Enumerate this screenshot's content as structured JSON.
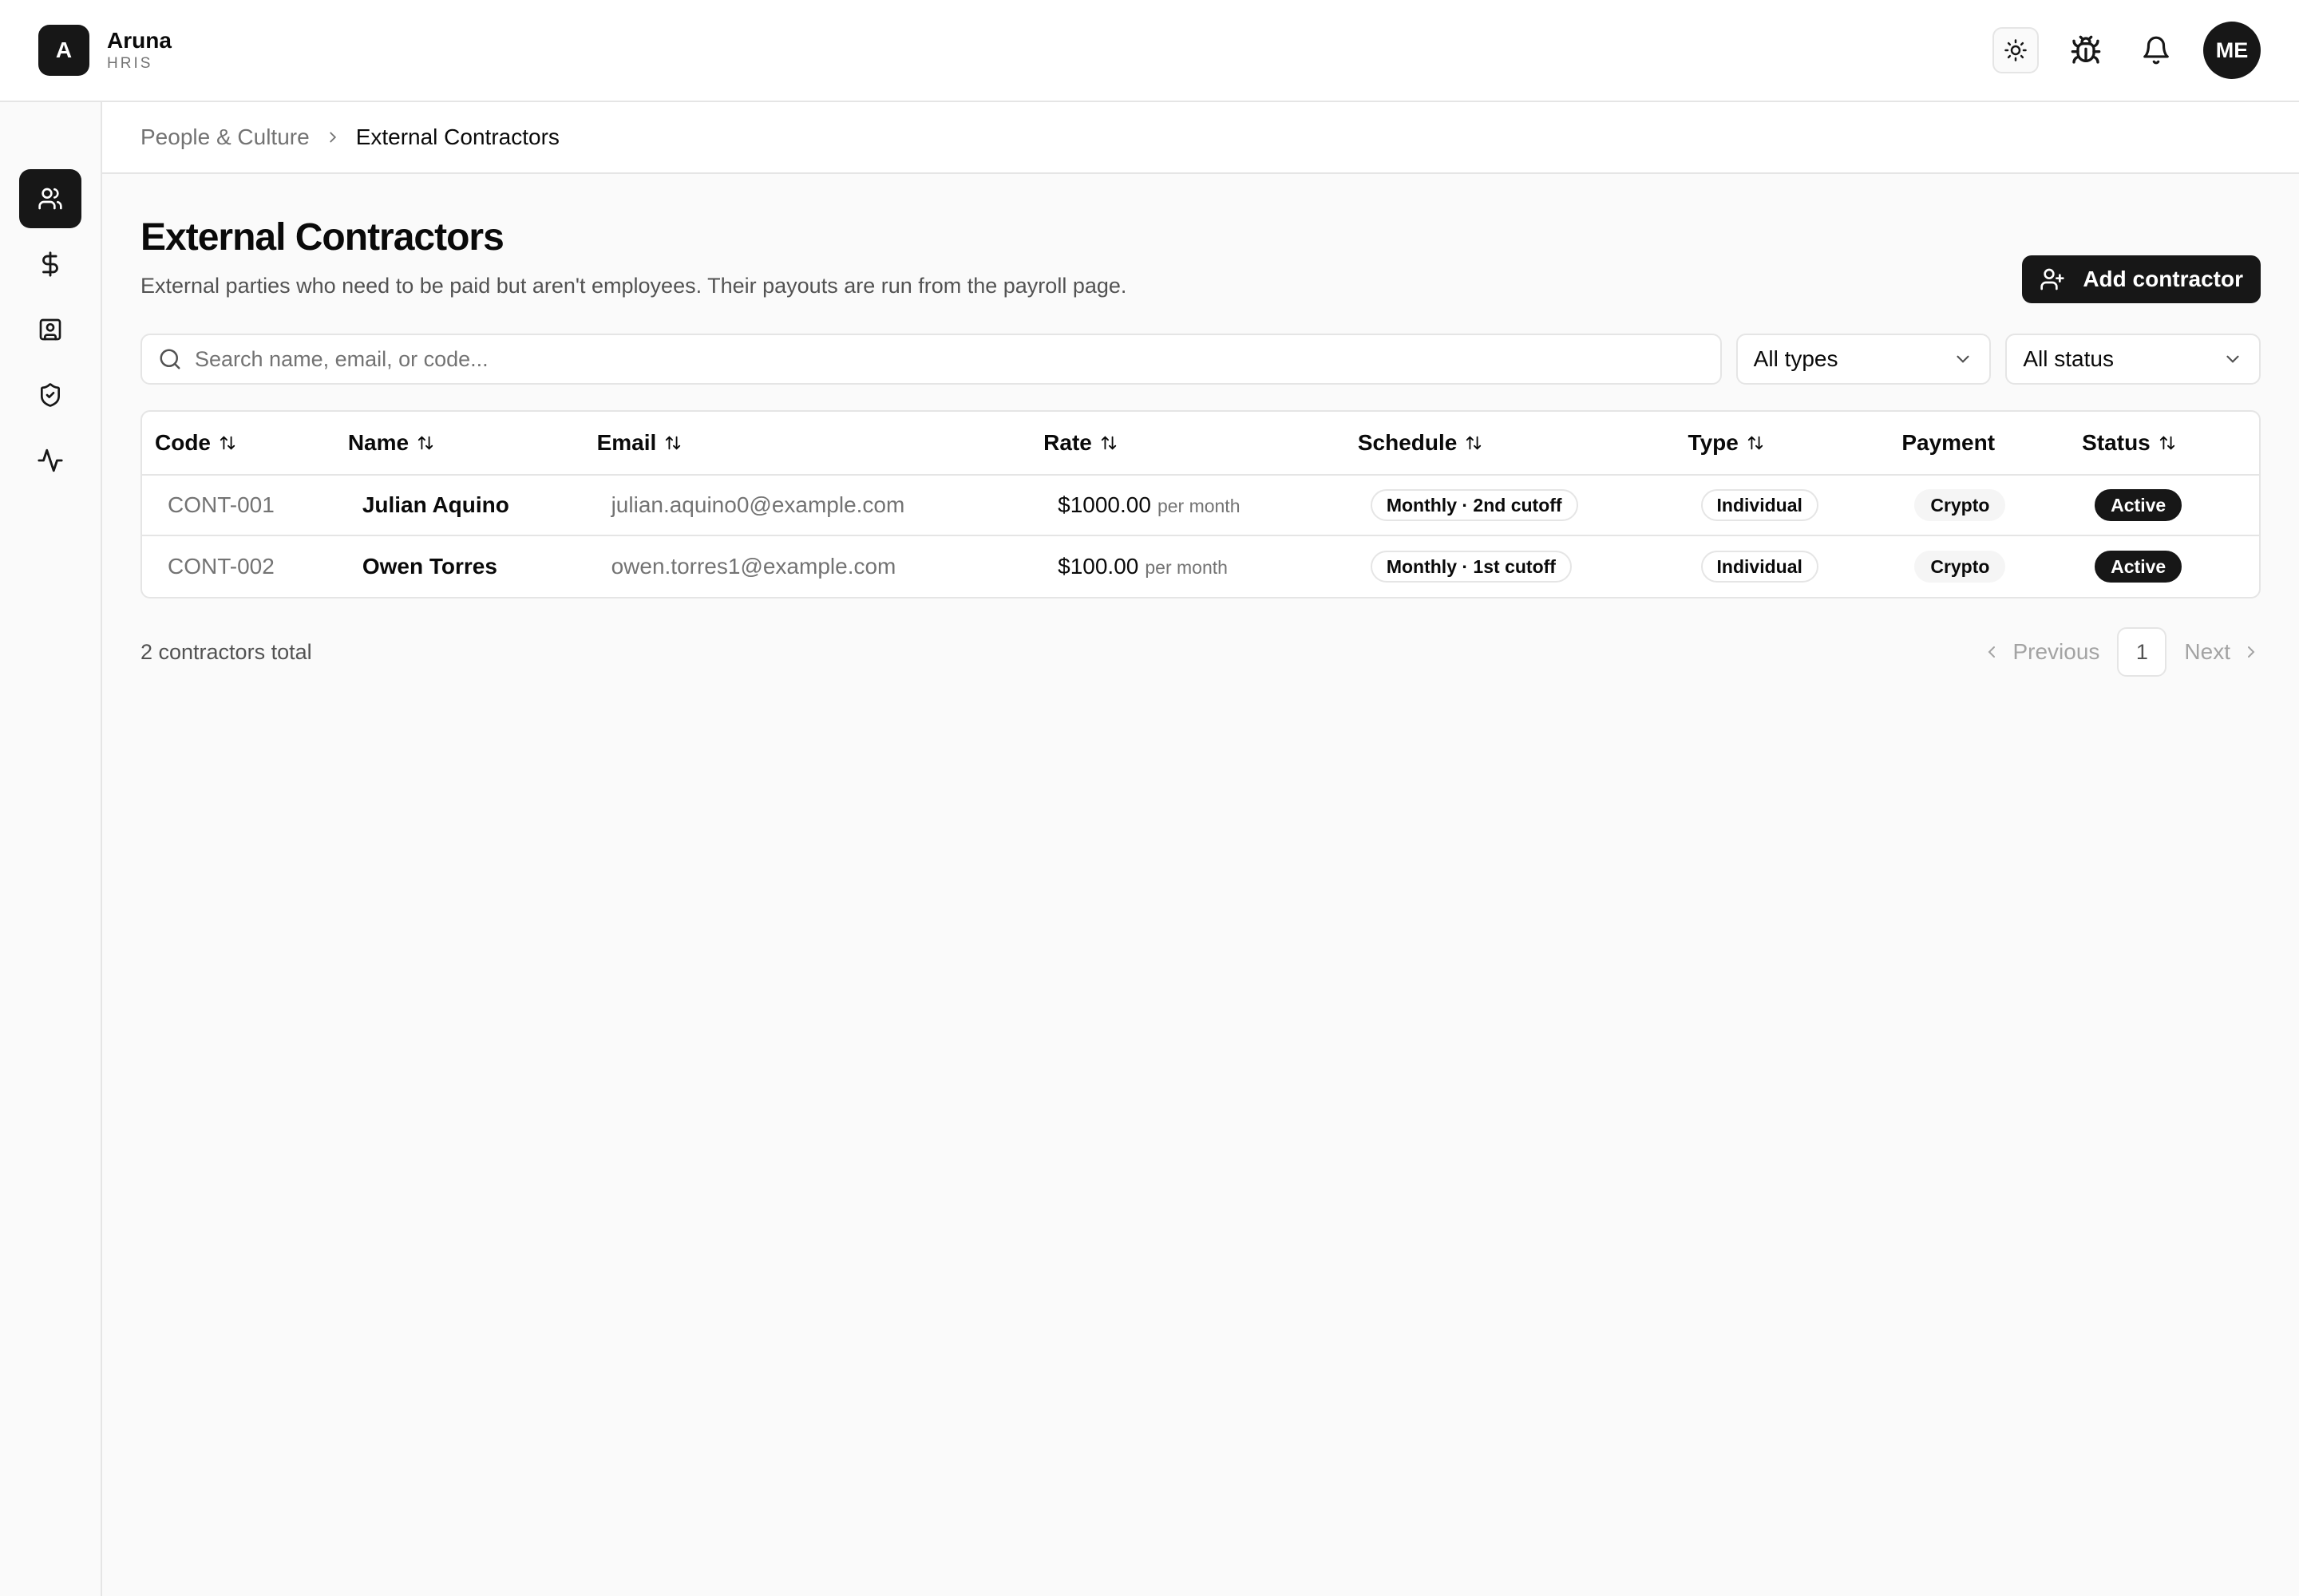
{
  "brand": {
    "logo_letter": "A",
    "name": "Aruna",
    "sub": "HRIS"
  },
  "topbar": {
    "icons": [
      "sun-icon",
      "bug-icon",
      "bell-icon"
    ],
    "avatar_initials": "ME"
  },
  "sidebar": {
    "items": [
      {
        "icon": "users-icon",
        "active": true
      },
      {
        "icon": "dollar-icon",
        "active": false
      },
      {
        "icon": "contact-card-icon",
        "active": false
      },
      {
        "icon": "shield-check-icon",
        "active": false
      },
      {
        "icon": "activity-icon",
        "active": false
      }
    ]
  },
  "breadcrumb": {
    "parent": "People & Culture",
    "current": "External Contractors"
  },
  "page": {
    "title": "External Contractors",
    "description": "External parties who need to be paid but aren't employees. Their payouts are run from the payroll page.",
    "add_button": "Add contractor"
  },
  "filters": {
    "search_placeholder": "Search name, email, or code...",
    "type_select": "All types",
    "status_select": "All status"
  },
  "table": {
    "headers": {
      "code": "Code",
      "name": "Name",
      "email": "Email",
      "rate": "Rate",
      "schedule": "Schedule",
      "type": "Type",
      "payment": "Payment",
      "status": "Status"
    },
    "rows": [
      {
        "code": "CONT-001",
        "name": "Julian Aquino",
        "email": "julian.aquino0@example.com",
        "rate": "$1000.00",
        "rate_unit": "per month",
        "schedule": "Monthly · 2nd cutoff",
        "type": "Individual",
        "payment": "Crypto",
        "status": "Active"
      },
      {
        "code": "CONT-002",
        "name": "Owen Torres",
        "email": "owen.torres1@example.com",
        "rate": "$100.00",
        "rate_unit": "per month",
        "schedule": "Monthly · 1st cutoff",
        "type": "Individual",
        "payment": "Crypto",
        "status": "Active"
      }
    ]
  },
  "footer": {
    "total_text": "2 contractors total",
    "prev_label": "Previous",
    "page": "1",
    "next_label": "Next"
  },
  "colors": {
    "primary": "#171717",
    "muted_text": "#737373",
    "border": "#e5e5e5",
    "background": "#fafafa"
  }
}
